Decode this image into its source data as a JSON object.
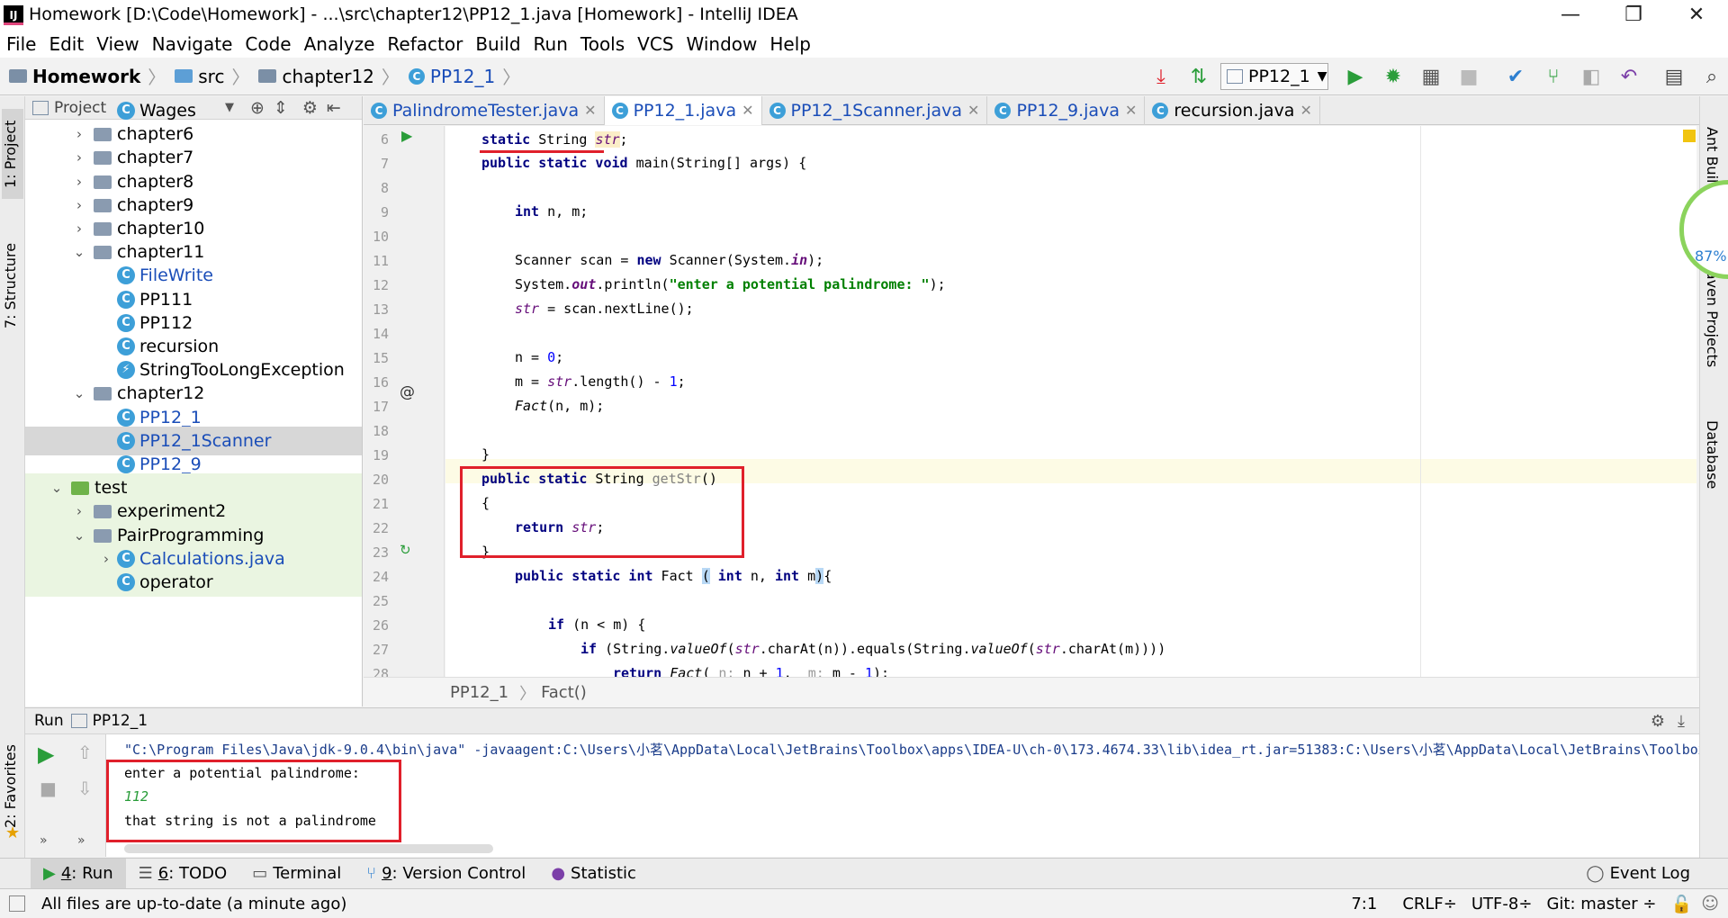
{
  "window": {
    "title": "Homework [D:\\Code\\Homework] - ...\\src\\chapter12\\PP12_1.java [Homework] - IntelliJ IDEA",
    "app_icon": "IJ",
    "controls": [
      "—",
      "❐",
      "✕"
    ]
  },
  "menu": [
    "File",
    "Edit",
    "View",
    "Navigate",
    "Code",
    "Analyze",
    "Refactor",
    "Build",
    "Run",
    "Tools",
    "VCS",
    "Window",
    "Help"
  ],
  "breadcrumb": [
    "Homework",
    "src",
    "chapter12",
    "PP12_1"
  ],
  "run_config": "PP12_1",
  "left_tabs": {
    "project": "1: Project",
    "structure": "7: Structure",
    "favorites": "2: Favorites"
  },
  "right_tabs": {
    "ant": "Ant Build",
    "maven": "Maven Projects",
    "database": "Database"
  },
  "memory_gauge": "87%",
  "project": {
    "header": "Project",
    "tree": [
      {
        "label": "Wages",
        "kind": "class"
      },
      {
        "label": "chapter6",
        "kind": "folder",
        "arrow": "›"
      },
      {
        "label": "chapter7",
        "kind": "folder",
        "arrow": "›"
      },
      {
        "label": "chapter8",
        "kind": "folder",
        "arrow": "›"
      },
      {
        "label": "chapter9",
        "kind": "folder",
        "arrow": "›"
      },
      {
        "label": "chapter10",
        "kind": "folder",
        "arrow": "›"
      },
      {
        "label": "chapter11",
        "kind": "folder",
        "arrow": "⌄"
      },
      {
        "label": "FileWrite",
        "kind": "class"
      },
      {
        "label": "PP111",
        "kind": "class"
      },
      {
        "label": "PP112",
        "kind": "class"
      },
      {
        "label": "recursion",
        "kind": "class"
      },
      {
        "label": "StringTooLongException",
        "kind": "exception"
      },
      {
        "label": "chapter12",
        "kind": "folder",
        "arrow": "⌄"
      },
      {
        "label": "PP12_1",
        "kind": "class"
      },
      {
        "label": "PP12_1Scanner",
        "kind": "class"
      },
      {
        "label": "PP12_9",
        "kind": "class"
      },
      {
        "label": "test",
        "kind": "folder",
        "arrow": "⌄"
      },
      {
        "label": "experiment2",
        "kind": "folder",
        "arrow": "›"
      },
      {
        "label": "PairProgramming",
        "kind": "folder",
        "arrow": "⌄"
      },
      {
        "label": "Calculations.java",
        "kind": "class",
        "arrow": "›"
      },
      {
        "label": "operator",
        "kind": "class"
      }
    ]
  },
  "tabs": [
    "PalindromeTester.java",
    "PP12_1.java",
    "PP12_1Scanner.java",
    "PP12_9.java",
    "recursion.java"
  ],
  "code": {
    "line_numbers": [
      "6",
      "7",
      "8",
      "9",
      "10",
      "11",
      "12",
      "13",
      "14",
      "15",
      "16",
      "17",
      "18",
      "19",
      "20",
      "21",
      "22",
      "23",
      "24",
      "25",
      "26",
      "27",
      "28"
    ]
  },
  "editor_breadcrumb": [
    "PP12_1",
    "Fact()"
  ],
  "run": {
    "label": "Run",
    "config": "PP12_1",
    "output": [
      "\"C:\\Program Files\\Java\\jdk-9.0.4\\bin\\java\" -javaagent:C:\\Users\\小茗\\AppData\\Local\\JetBrains\\Toolbox\\apps\\IDEA-U\\ch-0\\173.4674.33\\lib\\idea_rt.jar=51383:C:\\Users\\小茗\\AppData\\Local\\JetBrains\\Toolbox",
      "enter a potential palindrome:",
      "112",
      "that string is not a palindrome"
    ]
  },
  "bottom_tools": [
    {
      "key": "4",
      "label": ": Run"
    },
    {
      "key": "6",
      "label": ": TODO"
    },
    {
      "key": "",
      "label": "Terminal"
    },
    {
      "key": "9",
      "label": ": Version Control"
    },
    {
      "key": "",
      "label": "Statistic"
    }
  ],
  "event_log": "Event Log",
  "status": {
    "message": "All files are up-to-date (a minute ago)",
    "position": "7:1",
    "line_sep": "CRLF÷",
    "encoding": "UTF-8÷",
    "vcs": "Git: master ÷"
  }
}
